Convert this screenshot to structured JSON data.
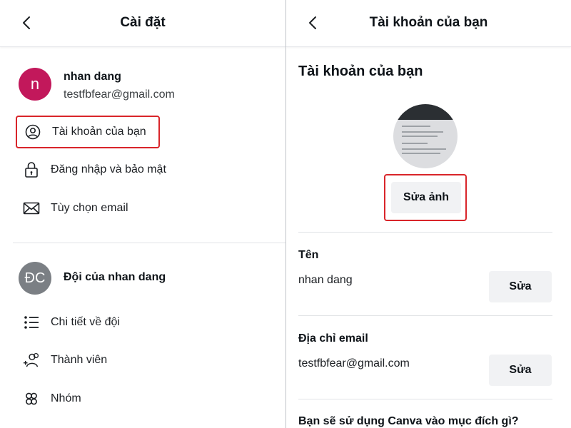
{
  "left_panel": {
    "title": "Cài đặt",
    "profile": {
      "avatar_letter": "n",
      "name": "nhan dang",
      "email": "testfbfear@gmail.com"
    },
    "account_items": [
      {
        "label": "Tài khoản của bạn",
        "icon": "user-circle-icon",
        "highlighted": true
      },
      {
        "label": "Đăng nhập và bảo mật",
        "icon": "lock-icon"
      },
      {
        "label": "Tùy chọn email",
        "icon": "envelope-icon"
      }
    ],
    "team": {
      "avatar_letters": "ĐC",
      "name": "Đội của nhan dang"
    },
    "team_items": [
      {
        "label": "Chi tiết về đội",
        "icon": "list-icon"
      },
      {
        "label": "Thành viên",
        "icon": "add-member-icon"
      },
      {
        "label": "Nhóm",
        "icon": "group-icon"
      }
    ]
  },
  "right_panel": {
    "title": "Tài khoản của bạn",
    "section_title": "Tài khoản của bạn",
    "edit_photo_label": "Sửa ảnh",
    "fields": [
      {
        "label": "Tên",
        "value": "nhan dang",
        "edit_label": "Sửa"
      },
      {
        "label": "Địa chỉ email",
        "value": "testfbfear@gmail.com",
        "edit_label": "Sửa"
      }
    ],
    "question": "Bạn sẽ sử dụng Canva vào mục đích gì?"
  },
  "colors": {
    "highlight": "#d9252a",
    "user_avatar": "#c2185b",
    "team_avatar": "#7b7f84",
    "button_bg": "#f1f2f4"
  }
}
